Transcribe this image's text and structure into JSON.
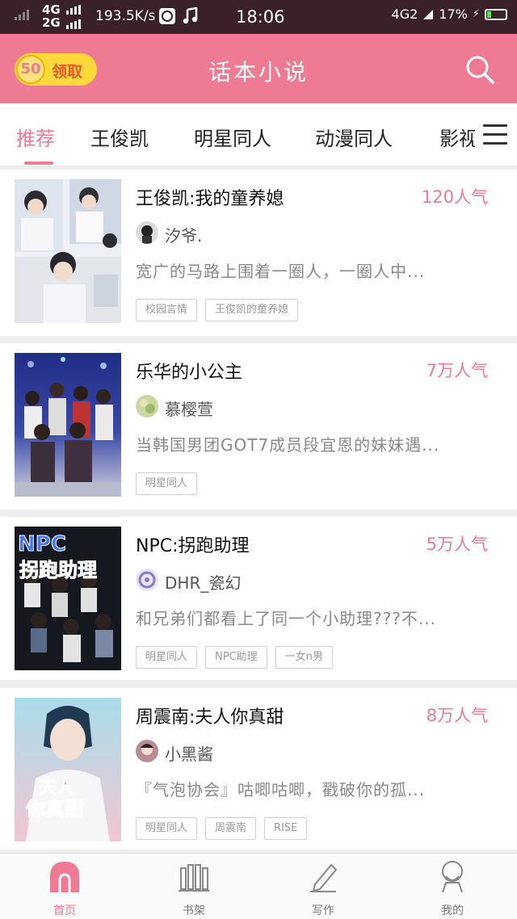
{
  "status_bar": {
    "network_top": "4G",
    "network_bottom": "2G",
    "speed": "193.5K/s",
    "time": "18:06",
    "network_right": "4G2",
    "battery": "17%"
  },
  "header": {
    "reward_amount": "50",
    "reward_label": "领取",
    "title": "话本小说"
  },
  "tabs": [
    {
      "label": "推荐",
      "active": true
    },
    {
      "label": "王俊凯",
      "active": false
    },
    {
      "label": "明星同人",
      "active": false
    },
    {
      "label": "动漫同人",
      "active": false
    },
    {
      "label": "影视",
      "active": false
    }
  ],
  "books": [
    {
      "title": "王俊凯:我的童养媳",
      "popularity": "120人气",
      "author": "汐爷.",
      "description": "宽广的马路上围着一圈人，一圈人中...",
      "tags": [
        "校园言情",
        "王俊凯的童养媳"
      ],
      "cover_colors": [
        "#e9eef4",
        "#c9d3de"
      ]
    },
    {
      "title": "乐华的小公主",
      "popularity": "7万人气",
      "author": "慕樱萱",
      "description": "当韩国男团GOT7成员段宜恩的妹妹遇...",
      "tags": [
        "明星同人"
      ],
      "cover_colors": [
        "#2b3a8c",
        "#c4c6d8"
      ]
    },
    {
      "title": "NPC:拐跑助理",
      "popularity": "5万人气",
      "author": "DHR_瓷幻",
      "description": "和兄弟们都看上了同一个小助理???不...",
      "tags": [
        "明星同人",
        "NPC助理",
        "一女n男"
      ],
      "cover_colors": [
        "#1c1f2e",
        "#5c6580"
      ]
    },
    {
      "title": "周震南:夫人你真甜",
      "popularity": "8万人气",
      "author": "小黑酱",
      "description": "『气泡协会』咕唧咕唧，戳破你的孤...",
      "tags": [
        "明星同人",
        "周震南",
        "RISE"
      ],
      "cover_colors": [
        "#9fd4e6",
        "#e7b8c8"
      ]
    }
  ],
  "cover_text": {
    "npc_1": "NPC",
    "npc_2": "拐跑助理",
    "sweet_1": "夫人",
    "sweet_2": "你真甜"
  },
  "bottom_nav": [
    {
      "label": "首页",
      "icon": "home-icon",
      "active": true
    },
    {
      "label": "书架",
      "icon": "bookshelf-icon",
      "active": false
    },
    {
      "label": "写作",
      "icon": "pen-icon",
      "active": false
    },
    {
      "label": "我的",
      "icon": "profile-icon",
      "active": false
    }
  ],
  "colors": {
    "accent": "#ef7a93",
    "status_bar": "#3a2128",
    "reward_bg": "#ffd93a"
  }
}
